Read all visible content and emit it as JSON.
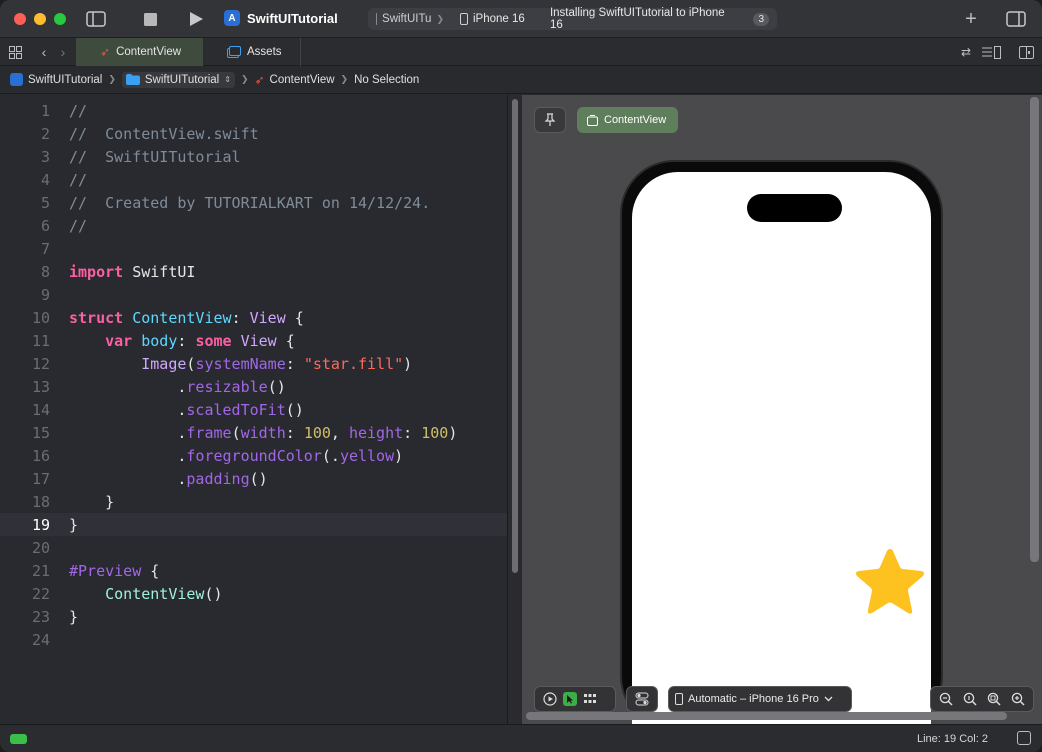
{
  "window": {
    "project_name": "SwiftUITutorial",
    "app_icon": "xcode-app-icon"
  },
  "status": {
    "scheme": "SwiftUITu",
    "device": "iPhone 16",
    "message": "Installing SwiftUITutorial to iPhone 16",
    "badge_count": "3"
  },
  "tabs": [
    {
      "label": "ContentView",
      "icon": "swift-icon",
      "active": true
    },
    {
      "label": "Assets",
      "icon": "assets-icon",
      "active": false
    }
  ],
  "breadcrumb": [
    {
      "label": "SwiftUITutorial",
      "icon": "project-icon"
    },
    {
      "label": "SwiftUITutorial",
      "icon": "folder-icon"
    },
    {
      "label": "ContentView",
      "icon": "swift-icon"
    },
    {
      "label": "No Selection",
      "icon": ""
    }
  ],
  "editor": {
    "current_line": 19,
    "lines": [
      {
        "n": "1",
        "tokens": [
          {
            "t": "//",
            "c": "cm"
          }
        ]
      },
      {
        "n": "2",
        "tokens": [
          {
            "t": "//  ContentView.swift",
            "c": "cm"
          }
        ]
      },
      {
        "n": "3",
        "tokens": [
          {
            "t": "//  SwiftUITutorial",
            "c": "cm"
          }
        ]
      },
      {
        "n": "4",
        "tokens": [
          {
            "t": "//",
            "c": "cm"
          }
        ]
      },
      {
        "n": "5",
        "tokens": [
          {
            "t": "//  Created by TUTORIALKART on 14/12/24.",
            "c": "cm"
          }
        ]
      },
      {
        "n": "6",
        "tokens": [
          {
            "t": "//",
            "c": "cm"
          }
        ]
      },
      {
        "n": "7",
        "tokens": []
      },
      {
        "n": "8",
        "tokens": [
          {
            "t": "import",
            "c": "kw"
          },
          {
            "t": " SwiftUI",
            "c": ""
          }
        ]
      },
      {
        "n": "9",
        "tokens": []
      },
      {
        "n": "10",
        "tokens": [
          {
            "t": "struct",
            "c": "kw"
          },
          {
            "t": " ",
            "c": ""
          },
          {
            "t": "ContentView",
            "c": "ty"
          },
          {
            "t": ": ",
            "c": ""
          },
          {
            "t": "View",
            "c": "ty2"
          },
          {
            "t": " {",
            "c": ""
          }
        ]
      },
      {
        "n": "11",
        "tokens": [
          {
            "t": "    ",
            "c": ""
          },
          {
            "t": "var",
            "c": "kw"
          },
          {
            "t": " ",
            "c": ""
          },
          {
            "t": "body",
            "c": "ty"
          },
          {
            "t": ": ",
            "c": ""
          },
          {
            "t": "some",
            "c": "kw"
          },
          {
            "t": " ",
            "c": ""
          },
          {
            "t": "View",
            "c": "ty2"
          },
          {
            "t": " {",
            "c": ""
          }
        ]
      },
      {
        "n": "12",
        "tokens": [
          {
            "t": "        ",
            "c": ""
          },
          {
            "t": "Image",
            "c": "ty2"
          },
          {
            "t": "(",
            "c": ""
          },
          {
            "t": "systemName",
            "c": "fn"
          },
          {
            "t": ": ",
            "c": ""
          },
          {
            "t": "\"star.fill\"",
            "c": "st"
          },
          {
            "t": ")",
            "c": ""
          }
        ]
      },
      {
        "n": "13",
        "tokens": [
          {
            "t": "            .",
            "c": ""
          },
          {
            "t": "resizable",
            "c": "fn"
          },
          {
            "t": "()",
            "c": ""
          }
        ]
      },
      {
        "n": "14",
        "tokens": [
          {
            "t": "            .",
            "c": ""
          },
          {
            "t": "scaledToFit",
            "c": "fn"
          },
          {
            "t": "()",
            "c": ""
          }
        ]
      },
      {
        "n": "15",
        "tokens": [
          {
            "t": "            .",
            "c": ""
          },
          {
            "t": "frame",
            "c": "fn"
          },
          {
            "t": "(",
            "c": ""
          },
          {
            "t": "width",
            "c": "fn"
          },
          {
            "t": ": ",
            "c": ""
          },
          {
            "t": "100",
            "c": "nu"
          },
          {
            "t": ", ",
            "c": ""
          },
          {
            "t": "height",
            "c": "fn"
          },
          {
            "t": ": ",
            "c": ""
          },
          {
            "t": "100",
            "c": "nu"
          },
          {
            "t": ")",
            "c": ""
          }
        ]
      },
      {
        "n": "16",
        "tokens": [
          {
            "t": "            .",
            "c": ""
          },
          {
            "t": "foregroundColor",
            "c": "fn"
          },
          {
            "t": "(.",
            "c": ""
          },
          {
            "t": "yellow",
            "c": "fn"
          },
          {
            "t": ")",
            "c": ""
          }
        ]
      },
      {
        "n": "17",
        "tokens": [
          {
            "t": "            .",
            "c": ""
          },
          {
            "t": "padding",
            "c": "fn"
          },
          {
            "t": "()",
            "c": ""
          }
        ]
      },
      {
        "n": "18",
        "tokens": [
          {
            "t": "    }",
            "c": ""
          }
        ]
      },
      {
        "n": "19",
        "tokens": [
          {
            "t": "}",
            "c": ""
          }
        ]
      },
      {
        "n": "20",
        "tokens": []
      },
      {
        "n": "21",
        "tokens": [
          {
            "t": "#Preview",
            "c": "fn"
          },
          {
            "t": " {",
            "c": ""
          }
        ]
      },
      {
        "n": "22",
        "tokens": [
          {
            "t": "    ",
            "c": ""
          },
          {
            "t": "ContentView",
            "c": "tyb"
          },
          {
            "t": "()",
            "c": ""
          }
        ]
      },
      {
        "n": "23",
        "tokens": [
          {
            "t": "}",
            "c": ""
          }
        ]
      },
      {
        "n": "24",
        "tokens": []
      }
    ]
  },
  "preview": {
    "pin_icon": "pin-icon",
    "view_button_label": "ContentView",
    "device_selector_label": "Automatic – iPhone 16 Pro",
    "star_color": "#fec220"
  },
  "statusbar": {
    "position": "Line: 19  Col: 2"
  },
  "colors": {
    "accent_green": "#5f7e5b",
    "close": "#fe5f57",
    "minimize": "#febc2e",
    "zoom": "#28c840"
  }
}
